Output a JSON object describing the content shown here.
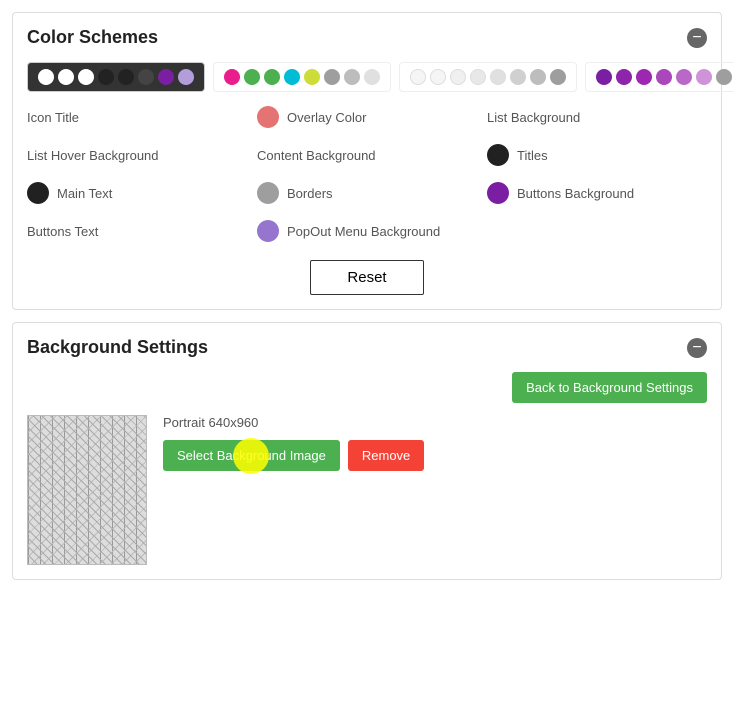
{
  "colorSchemes": {
    "title": "Color Schemes",
    "schemes": [
      {
        "id": "scheme-dark",
        "active": true,
        "colors": [
          "#fff",
          "#fff",
          "#fff",
          "#222",
          "#222",
          "#222",
          "#6a0dad",
          "#c9a0c9"
        ]
      },
      {
        "id": "scheme-pink",
        "active": false,
        "colors": [
          "#e91e8c",
          "#22bb33",
          "#22bb33",
          "#22bb33",
          "#00bcd4",
          "#d4e157",
          "#9e9e9e",
          "#9e9e9e"
        ]
      },
      {
        "id": "scheme-light",
        "active": false,
        "colors": [
          "#fff",
          "#fff",
          "#fff",
          "#fff",
          "#fff",
          "#fff",
          "#fff",
          "#fff"
        ]
      },
      {
        "id": "scheme-purple",
        "active": false,
        "colors": [
          "#7b1fa2",
          "#7b1fa2",
          "#7b1fa2",
          "#7b1fa2",
          "#7b1fa2",
          "#7b1fa2",
          "#9e9e9e",
          "#9e9e9e"
        ]
      },
      {
        "id": "scheme-dark2",
        "active": false,
        "colors": [
          "#6a0dad",
          "#6a0dad",
          "#6a0dad",
          "#00bcd4",
          "#d4e157",
          "#9e9e9e",
          "#9e9e9e",
          "#9e9e9e"
        ]
      }
    ],
    "colorItems": [
      {
        "label": "Icon Title",
        "color": null,
        "hasColor": false
      },
      {
        "label": "Overlay Color",
        "color": "#e57373",
        "hasColor": true
      },
      {
        "label": "List Background",
        "color": null,
        "hasColor": false
      },
      {
        "label": "List Hover Background",
        "color": null,
        "hasColor": false
      },
      {
        "label": "Content Background",
        "color": null,
        "hasColor": false
      },
      {
        "label": "Titles",
        "color": "#212121",
        "hasColor": true
      },
      {
        "label": "Main Text",
        "color": "#212121",
        "hasColor": true
      },
      {
        "label": "Borders",
        "color": "#9e9e9e",
        "hasColor": true
      },
      {
        "label": "Buttons Background",
        "color": "#7b1fa2",
        "hasColor": true
      },
      {
        "label": "Buttons Text",
        "color": null,
        "hasColor": false
      },
      {
        "label": "PopOut Menu Background",
        "color": "#9575cd",
        "hasColor": true
      }
    ],
    "resetLabel": "Reset"
  },
  "backgroundSettings": {
    "title": "Background Settings",
    "backButtonLabel": "Back to Background Settings",
    "portraitLabel": "Portrait 640x960",
    "selectButtonLabel": "Select Background Image",
    "removeButtonLabel": "Remove"
  },
  "schemeColors": {
    "scheme1": [
      "#ffffff",
      "#ffffff",
      "#ffffff",
      "#222222",
      "#222222",
      "#444444",
      "#7b1fa2",
      "#b39ddb"
    ],
    "scheme2": [
      "#e91e8c",
      "#4caf50",
      "#4caf50",
      "#00bcd4",
      "#00bcd4",
      "#cddc39",
      "#9e9e9e",
      "#757575"
    ],
    "scheme3": [
      "#ffffff",
      "#ffffff",
      "#f5f5f5",
      "#eeeeee",
      "#e0e0e0",
      "#bdbdbd",
      "#9e9e9e",
      "#757575"
    ],
    "scheme4": [
      "#7b1fa2",
      "#8e24aa",
      "#9c27b0",
      "#ab47bc",
      "#ba68c8",
      "#ce93d8",
      "#9e9e9e",
      "#757575"
    ],
    "scheme5": [
      "#4a148c",
      "#6a1b9a",
      "#7b1fa2",
      "#00bcd4",
      "#cddc39",
      "#9e9e9e",
      "#bdbdbd",
      "#e0e0e0"
    ]
  }
}
